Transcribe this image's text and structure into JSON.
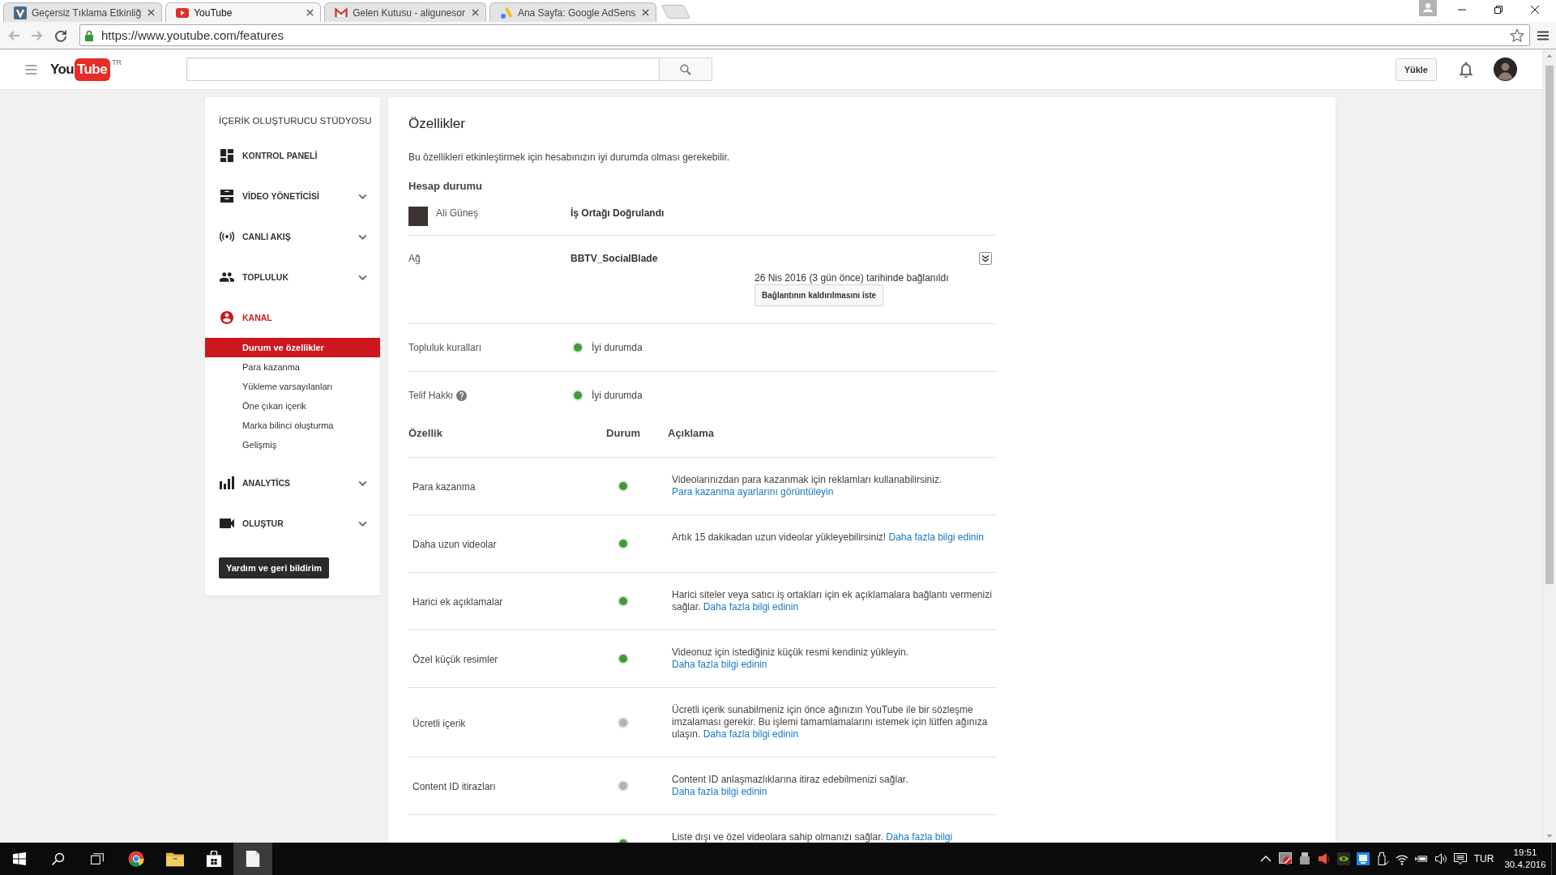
{
  "browser": {
    "tabs": [
      {
        "title": "Geçersiz Tıklama Etkinliğ",
        "selected": false
      },
      {
        "title": "YouTube",
        "selected": true
      },
      {
        "title": "Gelen Kutusu - aligunesor",
        "selected": false
      },
      {
        "title": "Ana Sayfa: Google AdSens",
        "selected": false
      }
    ],
    "url": "https://www.youtube.com/features"
  },
  "header": {
    "logo": {
      "text": "You",
      "badge": "Tube",
      "region": "TR"
    },
    "upload_button": "Yükle"
  },
  "sidebar": {
    "title": "İÇERİK OLUŞTURUCU STÜDYOSU",
    "items": [
      {
        "label": "KONTROL PANELİ",
        "selected": false,
        "has_menu": false
      },
      {
        "label": "VİDEO YÖNETİCİSİ",
        "selected": false,
        "has_menu": true
      },
      {
        "label": "CANLI AKIŞ",
        "selected": false,
        "has_menu": true
      },
      {
        "label": "TOPLULUK",
        "selected": false,
        "has_menu": true
      },
      {
        "label": "KANAL",
        "selected": true,
        "has_menu": false,
        "children": [
          {
            "label": "Durum ve özellikler",
            "selected": true
          },
          {
            "label": "Para kazanma",
            "selected": false
          },
          {
            "label": "Yükleme varsayılanları",
            "selected": false
          },
          {
            "label": "Öne çıkan içerik",
            "selected": false
          },
          {
            "label": "Marka bilinci oluşturma",
            "selected": false
          },
          {
            "label": "Gelişmiş",
            "selected": false
          }
        ]
      },
      {
        "label": "ANALYTİCS",
        "selected": false,
        "has_menu": true
      },
      {
        "label": "OLUŞTUR",
        "selected": false,
        "has_menu": true
      }
    ],
    "help_button": "Yardım ve geri bildirim"
  },
  "main": {
    "title": "Özellikler",
    "intro": "Bu özellikleri etkinleştirmek için hesabınızın iyi durumda olması gerekebilir.",
    "account": {
      "heading": "Hesap durumu",
      "name": "Ali Güneş",
      "status": "İş Ortağı Doğrulandı"
    },
    "network": {
      "label": "Ağ",
      "value": "BBTV_SocialBlade",
      "note": "26 Nis 2016 (3 gün önce) tarihinde bağlanıldı",
      "button": "Bağlantının kaldırılmasını iste"
    },
    "standing": [
      {
        "label": "Topluluk kuralları",
        "help": false,
        "good": true,
        "status": "İyi durumda"
      },
      {
        "label": "Telif Hakkı",
        "help": true,
        "good": true,
        "status": "İyi durumda"
      }
    ],
    "features": {
      "columns": [
        "Özellik",
        "Durum",
        "Açıklama"
      ],
      "rows": [
        {
          "name": "Para kazanma",
          "active": true,
          "description": "Videolarınızdan para kazanmak için reklamları kullanabilirsiniz.",
          "link": "Para kazanma ayarlarını görüntüleyin"
        },
        {
          "name": "Daha uzun videolar",
          "active": true,
          "description": "Artık 15 dakikadan uzun videolar yükleyebilirsiniz!",
          "link": "Daha fazla bilgi edinin"
        },
        {
          "name": "Harici ek açıklamalar",
          "active": true,
          "description": "Harici siteler veya satıcı iş ortakları için ek açıklamalara bağlantı vermenizi sağlar.",
          "link": "Daha fazla bilgi edinin"
        },
        {
          "name": "Özel küçük resimler",
          "active": true,
          "description": "Videonuz için istediğiniz küçük resmi kendiniz yükleyin.",
          "link": "Daha fazla bilgi edinin"
        },
        {
          "name": "Ücretli içerik",
          "active": false,
          "description": "Ücretli içerik sunabilmeniz için önce ağınızın YouTube ile bir sözleşme imzalaması gerekir. Bu işlemi tamamlamalarını istemek için lütfen ağınıza ulaşın.",
          "link": "Daha fazla bilgi edinin"
        },
        {
          "name": "Content ID itirazları",
          "active": false,
          "description": "Content ID anlaşmazlıklarına itiraz edebilmenizi sağlar.",
          "link": "Daha fazla bilgi edinin"
        },
        {
          "active": true,
          "description": "Liste dışı ve özel videolara sahip olmanızı sağlar.",
          "link": "Daha fazla bilgi"
        }
      ]
    }
  },
  "taskbar": {
    "apps": [
      {
        "highlighted": false
      },
      {
        "highlighted": false
      },
      {
        "highlighted": false
      },
      {
        "highlighted": true
      }
    ],
    "language": "TUR",
    "time": "19:51",
    "date": "30.4.2016"
  }
}
